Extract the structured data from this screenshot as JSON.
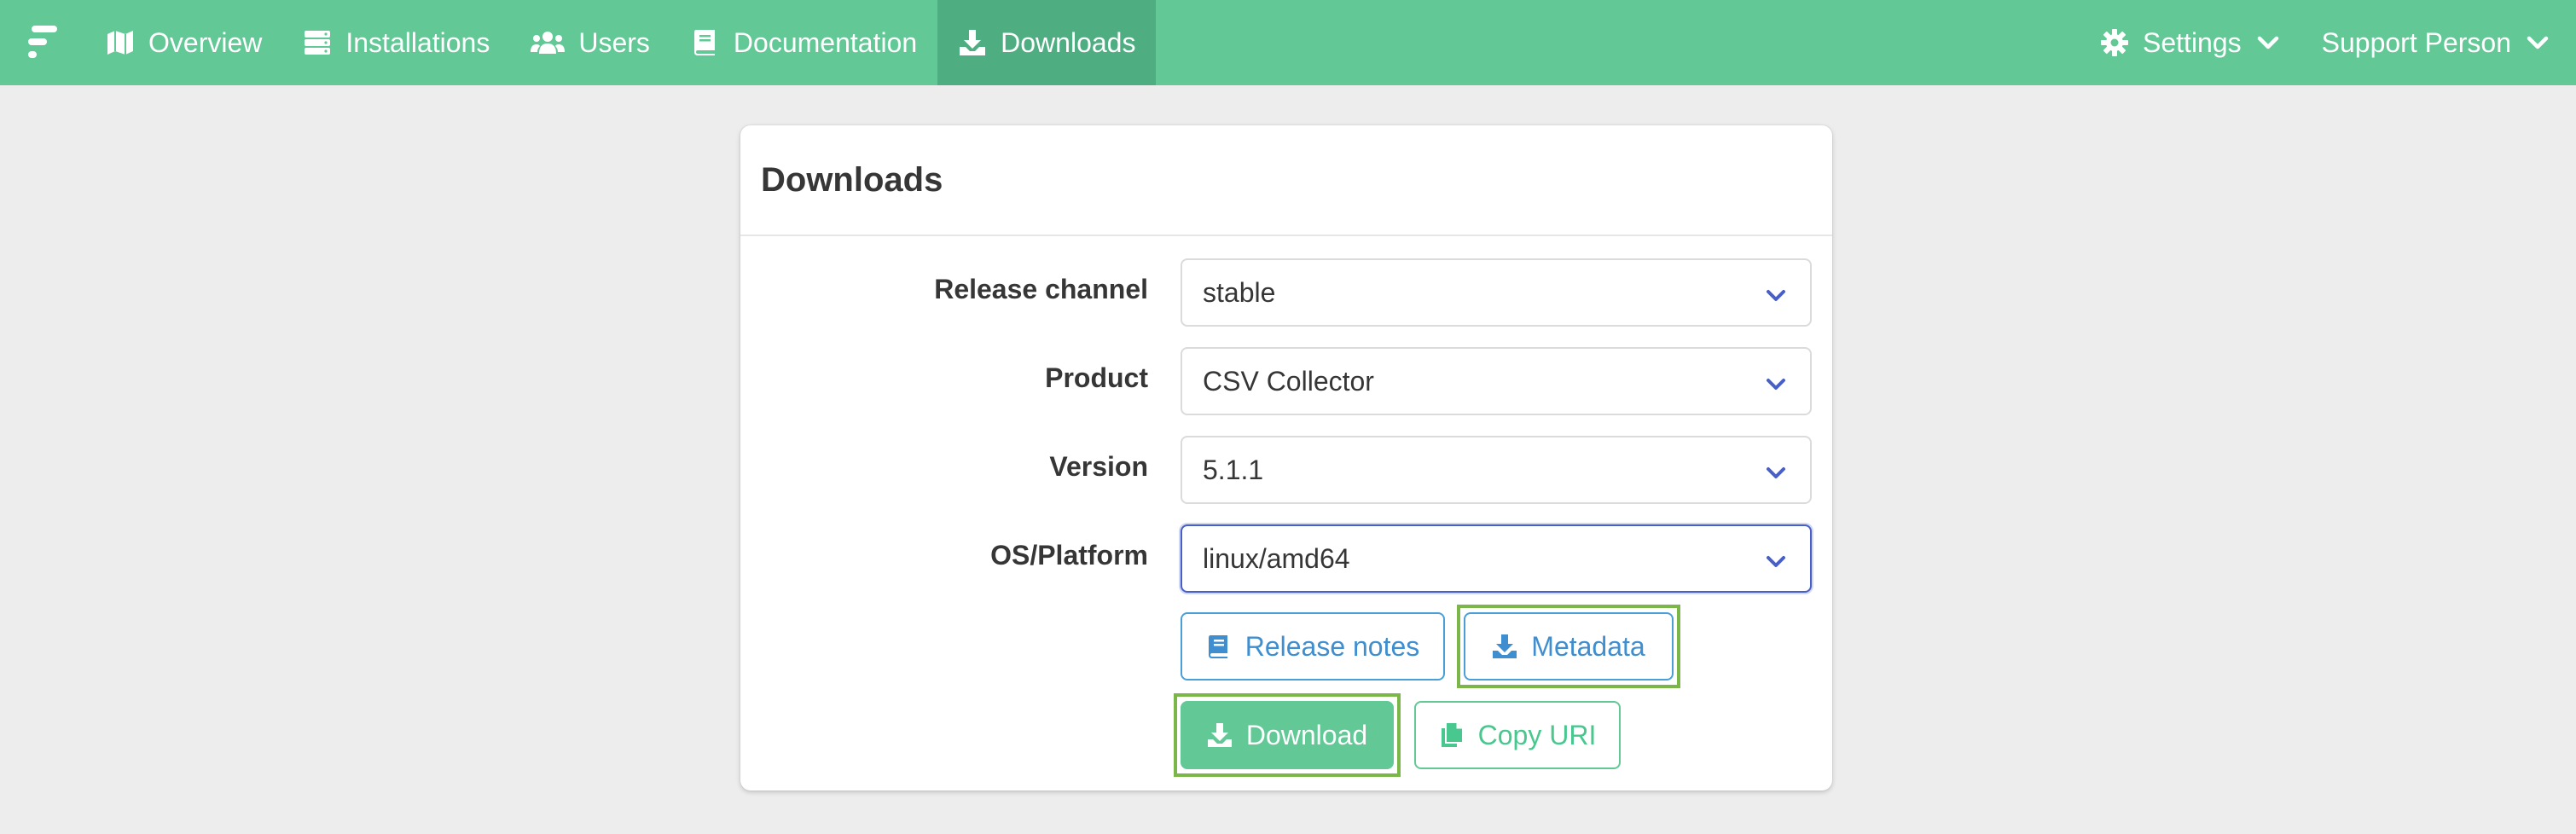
{
  "nav": {
    "items": [
      {
        "label": "Overview",
        "icon": "map-icon"
      },
      {
        "label": "Installations",
        "icon": "server-icon"
      },
      {
        "label": "Users",
        "icon": "users-icon"
      },
      {
        "label": "Documentation",
        "icon": "book-icon"
      },
      {
        "label": "Downloads",
        "icon": "download-icon",
        "active": true
      }
    ],
    "settings_label": "Settings",
    "user_label": "Support Person"
  },
  "card": {
    "title": "Downloads",
    "fields": {
      "release_channel": {
        "label": "Release channel",
        "value": "stable"
      },
      "product": {
        "label": "Product",
        "value": "CSV Collector"
      },
      "version": {
        "label": "Version",
        "value": "5.1.1"
      },
      "os_platform": {
        "label": "OS/Platform",
        "value": "linux/amd64"
      }
    },
    "buttons": {
      "release_notes": "Release notes",
      "metadata": "Metadata",
      "download": "Download",
      "copy_uri": "Copy URI"
    }
  },
  "colors": {
    "navbar": "#62c996",
    "navbar_active": "#4eae82",
    "info": "#3e8ed0",
    "success": "#48c78e",
    "focus": "#485fc7",
    "highlight": "#7ab648"
  }
}
